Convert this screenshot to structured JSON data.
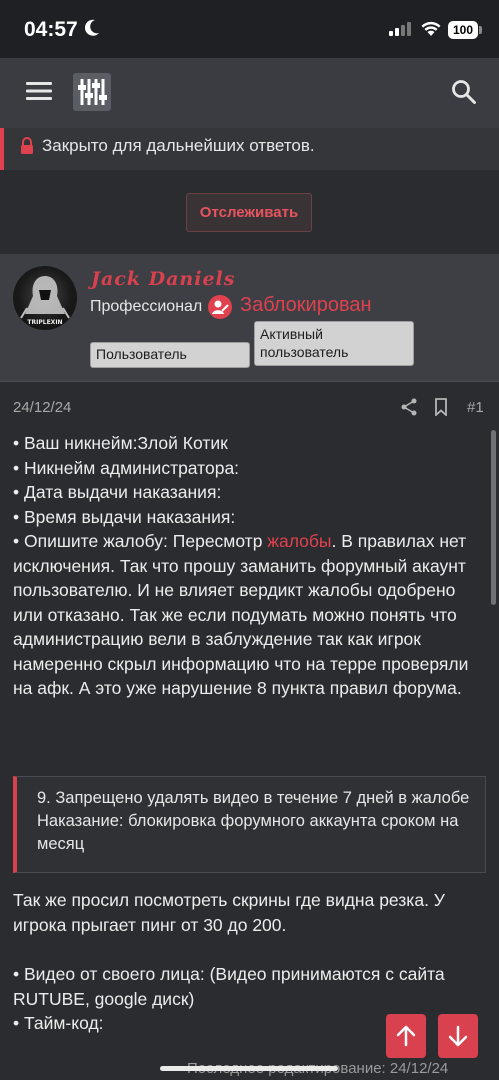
{
  "status": {
    "time": "04:57",
    "battery": "100"
  },
  "thread": {
    "closed_notice": "Закрыто для дальнейших ответов.",
    "watch_label": "Отслеживать"
  },
  "user": {
    "name": "Jack Daniels",
    "title": "Профессионал",
    "ban_status": "Заблокирован",
    "badges": [
      "Пользователь",
      "Активный пользователь"
    ],
    "avatar_text": "TRIPLEXIN"
  },
  "post": {
    "date": "24/12/24",
    "number": "#1",
    "lines": [
      "• Ваш никнейм:Злой Котик",
      "• Никнейм администратора:",
      "• Дата выдачи наказания:",
      "• Время выдачи наказания:"
    ],
    "complaint_prefix": "• Опишите жалобу: Пересмотр ",
    "complaint_link": "жалобы",
    "complaint_rest": ". В правилах нет исключения. Так что прошу заманить форумный акаунт пользователю. И не влияет вердикт жалобы одобрено или отказано. Так же если подумать можно понять что администрацию вели в заблуждение так как игрок намеренно скрыл информацию что на терре проверяли на афк. А это уже нарушение 8 пункта правил форума.",
    "quote": "9. Запрещено удалять видео в течение 7 дней в жалобе\nНаказание: блокировка форумного аккаунта сроком на месяц",
    "after_quote": "Так же просил посмотреть скрины где видна резка. У игрока прыгает пинг от 30 до 200.",
    "video_line": "• Видео от своего лица: (Видео принимаются с сайта RUTUBE, google диск)",
    "timecode_line": "• Тайм-код:",
    "last_edit": "Последнее редактирование: 24/12/24"
  }
}
